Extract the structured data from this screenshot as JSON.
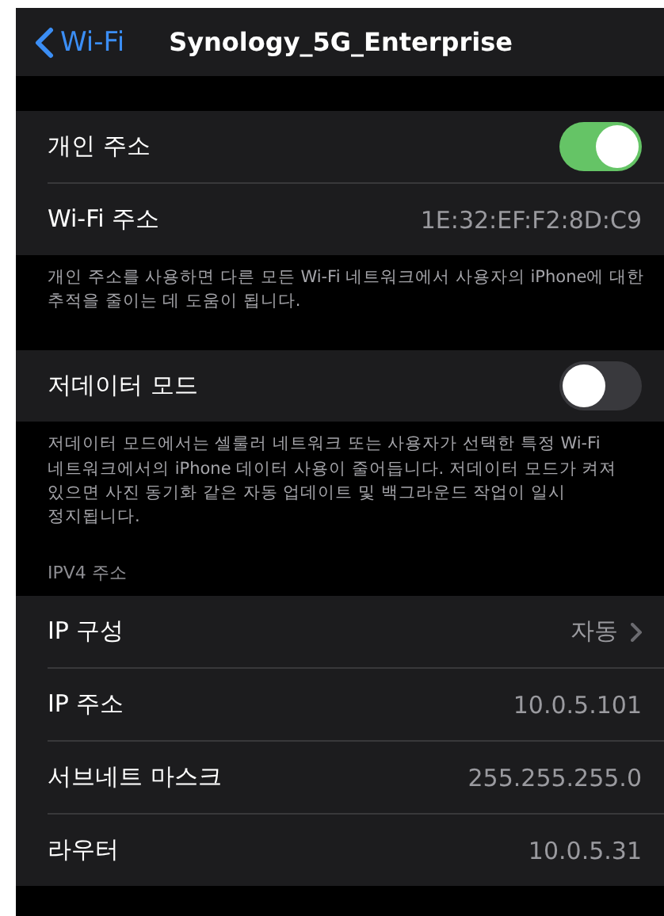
{
  "nav": {
    "back_label": "Wi-Fi",
    "title": "Synology_5G_Enterprise"
  },
  "sections": [
    {
      "rows": [
        {
          "kind": "toggle",
          "label": "개인 주소",
          "on": true
        },
        {
          "kind": "value",
          "label": "Wi-Fi 주소",
          "value": "1E:32:EF:F2:8D:C9"
        }
      ],
      "footer": "개인 주소를 사용하면 다른 모든 Wi-Fi 네트워크에서 사용자의 iPhone에 대한 추적을 줄이는 데 도움이 됩니다."
    },
    {
      "rows": [
        {
          "kind": "toggle",
          "label": "저데이터 모드",
          "on": false
        }
      ],
      "footer": "저데이터 모드에서는 셀룰러 네트워크 또는 사용자가 선택한 특정 Wi-Fi 네트워크에서의 iPhone 데이터 사용이 줄어듭니다. 저데이터 모드가 켜져 있으면 사진 동기화 같은 자동 업데이트 및 백그라운드 작업이 일시 정지됩니다."
    },
    {
      "header": "IPV4 주소",
      "rows": [
        {
          "kind": "link",
          "label": "IP 구성",
          "value": "자동"
        },
        {
          "kind": "value",
          "label": "IP 주소",
          "value": "10.0.5.101"
        },
        {
          "kind": "value",
          "label": "서브네트 마스크",
          "value": "255.255.255.0"
        },
        {
          "kind": "value",
          "label": "라우터",
          "value": "10.0.5.31"
        }
      ]
    }
  ]
}
